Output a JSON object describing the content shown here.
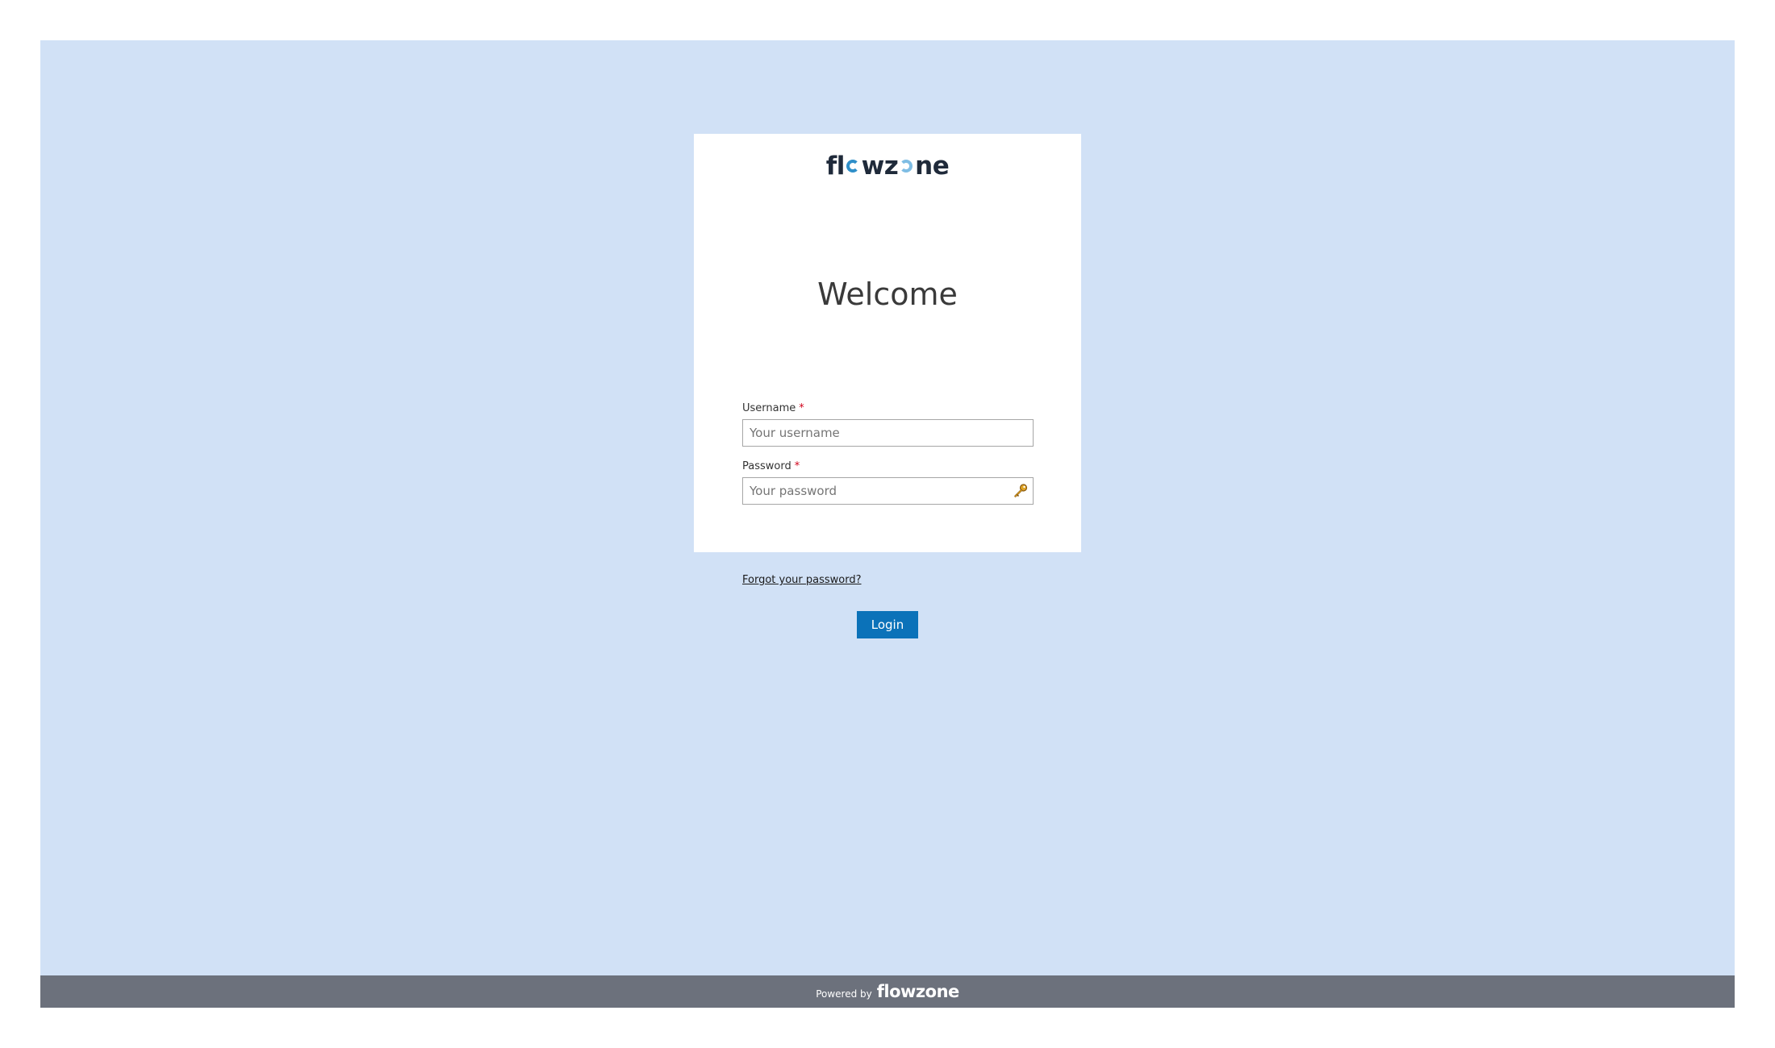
{
  "brand": {
    "logo_text": "flowzone",
    "logo_parts": [
      "fl",
      "o",
      "wz",
      "o",
      "ne"
    ]
  },
  "login": {
    "title": "Welcome",
    "username": {
      "label": "Username",
      "required_marker": "*",
      "placeholder": "Your username",
      "value": ""
    },
    "password": {
      "label": "Password",
      "required_marker": "*",
      "placeholder": "Your password",
      "value": "",
      "icon": "key-icon"
    },
    "forgot_link": "Forgot your password?",
    "submit_label": "Login"
  },
  "footer": {
    "powered_by": "Powered by",
    "logo_text": "flowzone"
  },
  "colors": {
    "background": "#d1e1f6",
    "card": "#ffffff",
    "primary_button": "#0b72b9",
    "footer": "#6c717c",
    "required": "#d0021b"
  }
}
